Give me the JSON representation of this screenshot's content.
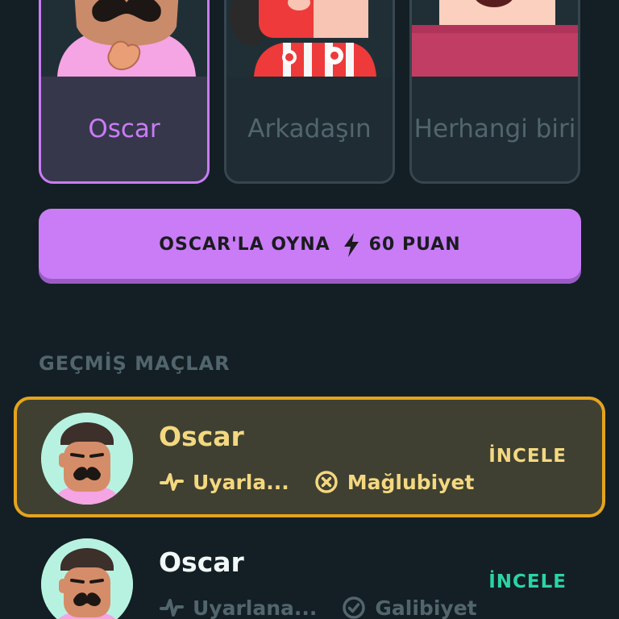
{
  "opponents": [
    {
      "label": "Oscar",
      "selected": true
    },
    {
      "label": "Arkadaşın",
      "selected": false
    },
    {
      "label": "Herhangi biri",
      "selected": false
    }
  ],
  "play_button": {
    "label": "OSCAR'LA OYNA",
    "points": "60 PUAN",
    "icon": "lightning-bolt-icon"
  },
  "history": {
    "title": "GEÇMİŞ MAÇLAR",
    "matches": [
      {
        "name": "Oscar",
        "mode": "Uyarla...",
        "result": "Mağlubiyet",
        "result_icon": "x-circle-icon",
        "action": "İNCELE",
        "highlighted": true
      },
      {
        "name": "Oscar",
        "mode": "Uyarlana...",
        "result": "Galibiyet",
        "result_icon": "check-circle-icon",
        "action": "İNCELE",
        "highlighted": false
      }
    ]
  },
  "colors": {
    "background": "#131f24",
    "accent_purple": "#c97cf6",
    "highlight_gold": "#e5a41d",
    "review_green": "#2bd3a6"
  }
}
